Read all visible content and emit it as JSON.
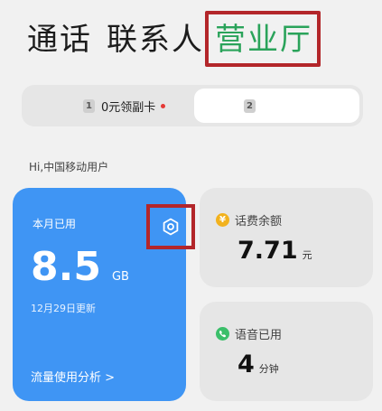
{
  "tabs": [
    {
      "label": "通话"
    },
    {
      "label": "联系人"
    },
    {
      "label": "营业厅"
    }
  ],
  "sim": {
    "card1_index": "1",
    "card1_label": "0元领副卡",
    "card2_index": "2"
  },
  "greeting": "Hi,中国移动用户",
  "data_usage": {
    "title": "本月已用",
    "value": "8.5",
    "unit": "GB",
    "updated": "12月29日更新",
    "analysis_link": "流量使用分析 >"
  },
  "balance": {
    "icon_symbol": "¥",
    "label": "话费余额",
    "value": "7.71",
    "unit": "元"
  },
  "voice": {
    "label": "语音已用",
    "value": "4",
    "unit": "分钟"
  },
  "colors": {
    "active_tab": "#2aa35a",
    "data_card": "#3f95f4",
    "highlight": "#b3262a",
    "notification_dot": "#e53935"
  }
}
